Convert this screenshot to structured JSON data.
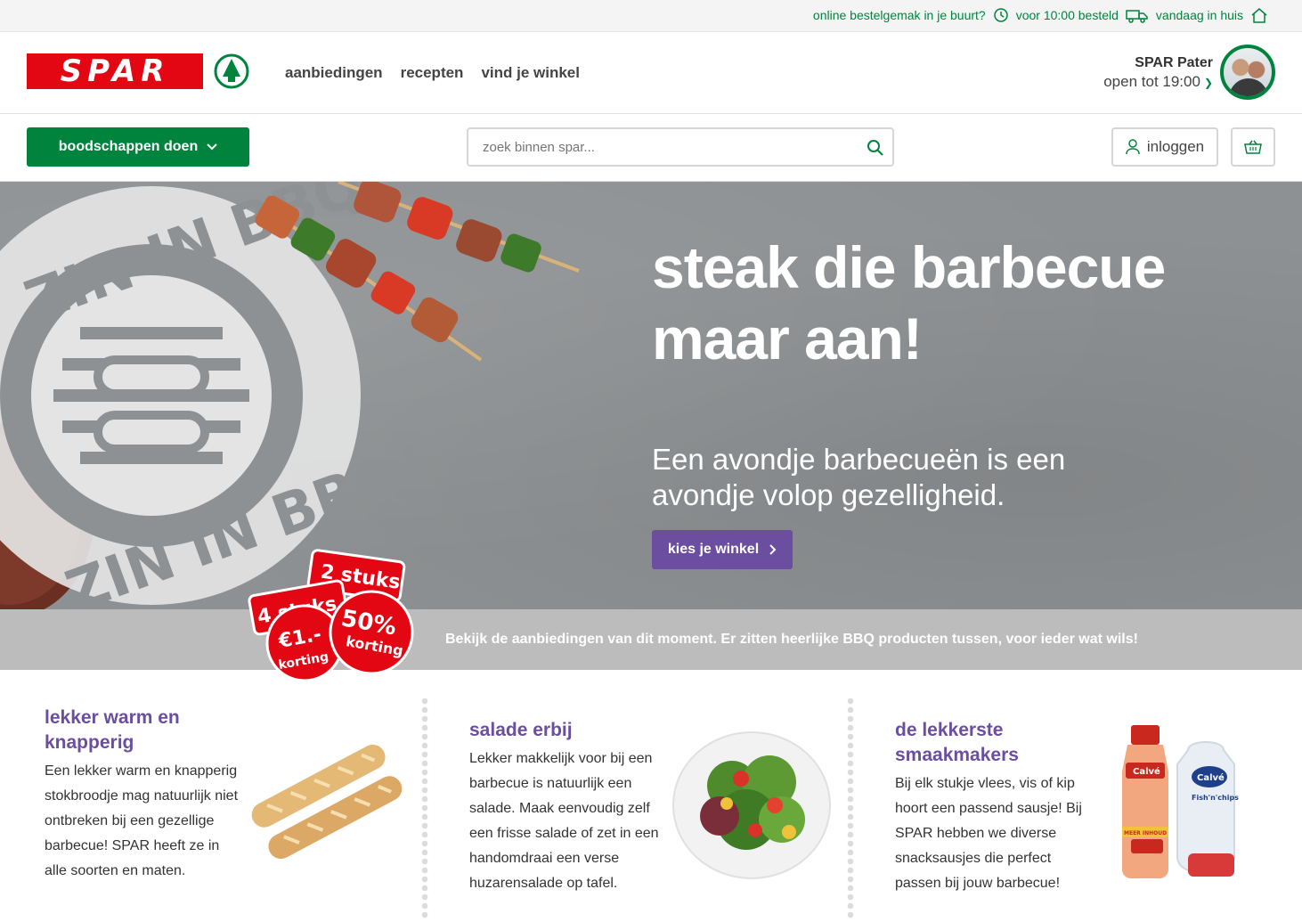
{
  "topbar": {
    "online": "online bestelgemak in je buurt?",
    "deadline": "voor 10:00 besteld",
    "delivery": "vandaag in huis"
  },
  "header": {
    "logo_text": "SPAR",
    "nav": [
      "aanbiedingen",
      "recepten",
      "vind je winkel"
    ],
    "store_name": "SPAR Pater",
    "store_hours": "open tot 19:00"
  },
  "subheader": {
    "shop_button": "boodschappen doen",
    "search_placeholder": "zoek binnen spar...",
    "login": "inloggen"
  },
  "hero": {
    "title": "steak die barbecue maar aan!",
    "subtitle": "Een avondje barbecueën is een avondje volop gezelligheid.",
    "cta": "kies je winkel",
    "stamp_text": "ZIN IN BBQ!",
    "badges": [
      "2 stuks",
      "4 stuks",
      "50%",
      "korting",
      "€1.-",
      "korting"
    ]
  },
  "banner": {
    "text": "Bekijk de aanbiedingen van dit moment. Er zitten heerlijke BBQ producten tussen, voor ieder wat wils!"
  },
  "features": [
    {
      "title": "lekker warm en knapperig",
      "text": "Een lekker warm en knapperig stokbroodje mag natuurlijk niet ontbreken bij een gezellige barbecue! SPAR heeft ze in alle soorten en maten."
    },
    {
      "title": "salade erbij",
      "text": "Lekker makkelijk voor bij een barbecue is natuurlijk een salade. Maak eenvoudig zelf een frisse salade of zet in een handomdraai een verse huzarensalade op tafel."
    },
    {
      "title": "de lekkerste smaakmakers",
      "text": "Bij elk stukje vlees, vis of kip hoort een passend sausje! Bij SPAR hebben we diverse snacksausjes die perfect passen bij jouw barbecue!",
      "product_labels": [
        "Calvé",
        "MEER INHOUD",
        "Calvé",
        "Fish'n'chips"
      ]
    }
  ],
  "colors": {
    "spar_red": "#e30613",
    "spar_green": "#00843d",
    "purple": "#6b4ea0"
  }
}
